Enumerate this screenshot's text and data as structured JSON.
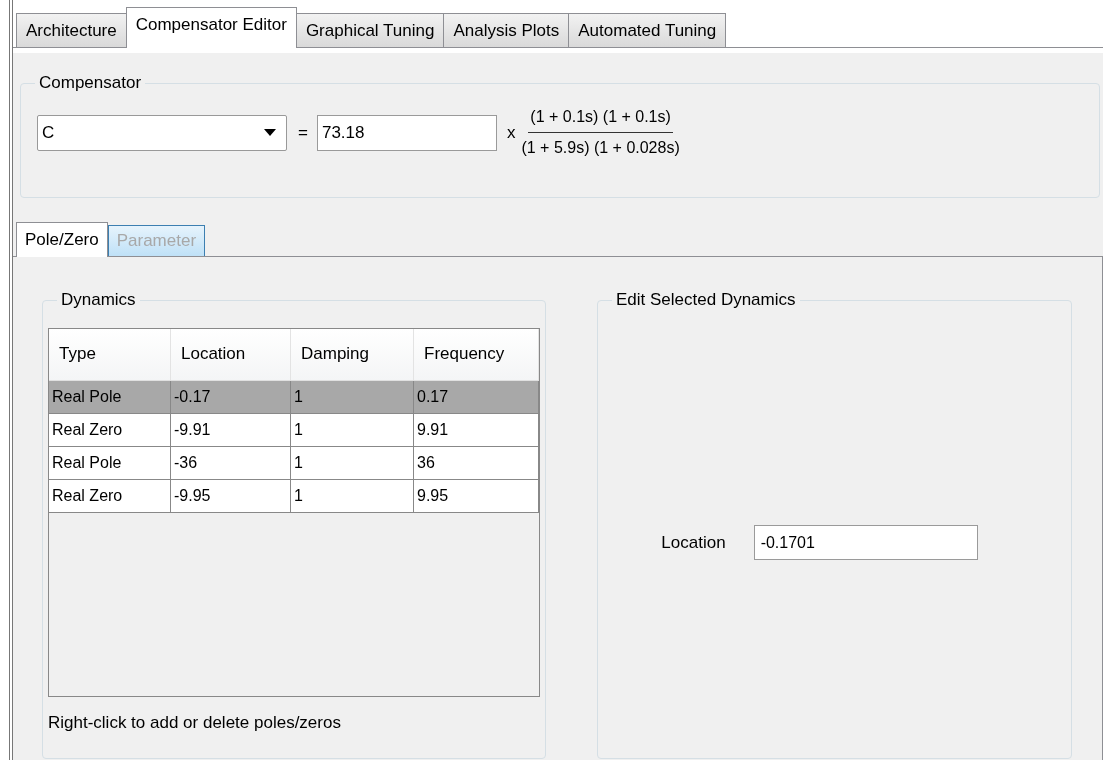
{
  "tabs": [
    {
      "label": "Architecture",
      "selected": false
    },
    {
      "label": "Compensator Editor",
      "selected": true
    },
    {
      "label": "Graphical Tuning",
      "selected": false
    },
    {
      "label": "Analysis Plots",
      "selected": false
    },
    {
      "label": "Automated Tuning",
      "selected": false
    }
  ],
  "compensator": {
    "title": "Compensator",
    "name": "C",
    "equals": "=",
    "gain": "73.18",
    "times": "x",
    "numerator": "(1 + 0.1s) (1 + 0.1s)",
    "denominator": "(1 + 5.9s) (1 + 0.028s)"
  },
  "subtabs": [
    {
      "label": "Pole/Zero",
      "selected": true,
      "disabled": false
    },
    {
      "label": "Parameter",
      "selected": false,
      "disabled": true
    }
  ],
  "dynamics": {
    "title": "Dynamics",
    "columns": [
      "Type",
      "Location",
      "Damping",
      "Frequency"
    ],
    "rows": [
      {
        "cells": [
          "Real Pole",
          "-0.17",
          "1",
          "0.17"
        ],
        "selected": true
      },
      {
        "cells": [
          "Real Zero",
          "-9.91",
          "1",
          "9.91"
        ],
        "selected": false
      },
      {
        "cells": [
          "Real Pole",
          "-36",
          "1",
          "36"
        ],
        "selected": false
      },
      {
        "cells": [
          "Real Zero",
          "-9.95",
          "1",
          "9.95"
        ],
        "selected": false
      }
    ],
    "hint": "Right-click to add or delete poles/zeros"
  },
  "edit": {
    "title": "Edit Selected Dynamics",
    "label": "Location",
    "value": "-0.1701"
  }
}
